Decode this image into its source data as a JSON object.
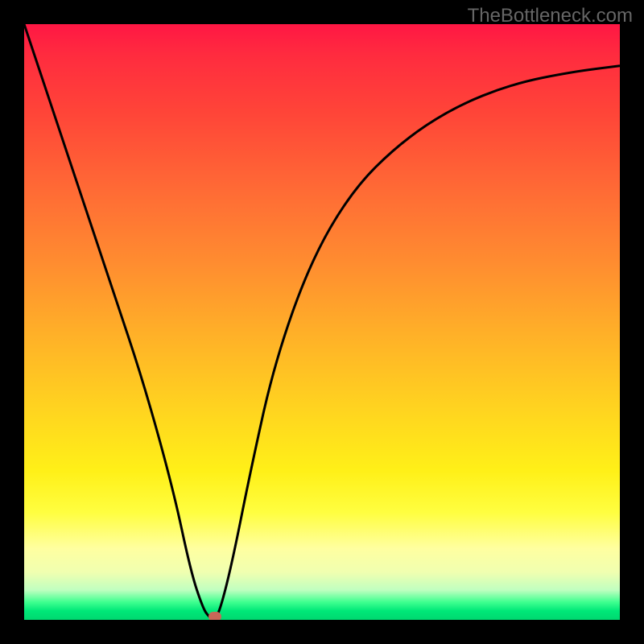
{
  "watermark_text": "TheBottleneck.com",
  "chart_data": {
    "type": "line",
    "title": "",
    "xlabel": "",
    "ylabel": "",
    "xlim": [
      0,
      100
    ],
    "ylim": [
      0,
      100
    ],
    "series": [
      {
        "name": "bottleneck-curve",
        "x": [
          0,
          5,
          10,
          15,
          20,
          25,
          28,
          30,
          31,
          32,
          33,
          35,
          38,
          42,
          48,
          55,
          63,
          72,
          82,
          92,
          100
        ],
        "values": [
          100,
          85,
          70,
          55,
          40,
          22,
          8,
          2,
          0.5,
          0,
          2,
          10,
          25,
          43,
          60,
          72,
          80,
          86,
          90,
          92,
          93
        ]
      }
    ],
    "marker": {
      "x": 32,
      "y": 0.5
    },
    "gradient_meaning": "green (low y) = good / no bottleneck; red (high y) = severe bottleneck"
  },
  "colors": {
    "curve": "#000000",
    "marker": "#c96758",
    "background_frame": "#000000"
  }
}
